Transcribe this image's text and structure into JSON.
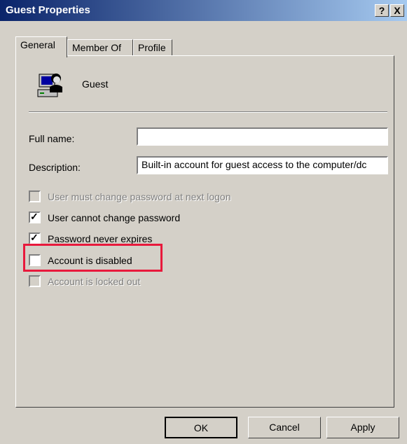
{
  "window": {
    "title": "Guest Properties",
    "help_label": "?",
    "close_label": "X"
  },
  "tabs": [
    {
      "label": "General",
      "active": true
    },
    {
      "label": "Member Of",
      "active": false
    },
    {
      "label": "Profile",
      "active": false
    }
  ],
  "user": {
    "icon": "user-computer-icon",
    "name": "Guest"
  },
  "fields": {
    "full_name_label": "Full name:",
    "full_name_value": "",
    "description_label": "Description:",
    "description_value": "Built-in account for guest access to the computer/dc"
  },
  "checkboxes": [
    {
      "label": "User must change password at next logon",
      "checked": false,
      "enabled": false
    },
    {
      "label": "User cannot change password",
      "checked": true,
      "enabled": true
    },
    {
      "label": "Password never expires",
      "checked": true,
      "enabled": true
    },
    {
      "label": "Account is disabled",
      "checked": false,
      "enabled": true
    },
    {
      "label": "Account is locked out",
      "checked": false,
      "enabled": false
    }
  ],
  "highlight_color": "#e8193c",
  "buttons": {
    "ok": "OK",
    "cancel": "Cancel",
    "apply": "Apply"
  }
}
